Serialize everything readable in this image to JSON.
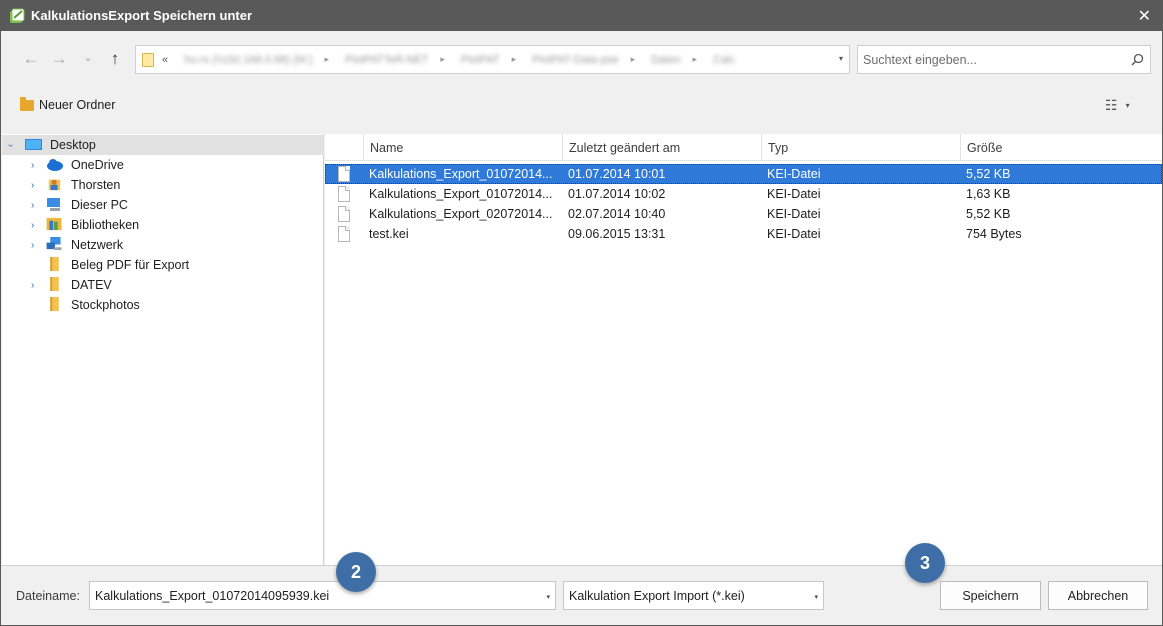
{
  "window": {
    "title": "KalkulationsExport Speichern unter",
    "app_icon": "kalkulation-app-icon",
    "close_glyph": "✕"
  },
  "nav": {
    "back_glyph": "←",
    "forward_glyph": "→",
    "recent_glyph": "⌄",
    "up_glyph": "↑",
    "address": {
      "chevron": "«",
      "crumbs": [
        "hu-rs (\\\\192.168.0.88) (M:)",
        "PlotPATTeR.NET",
        "PlotPAT",
        "PlotPAT-Data-pse",
        "Daten",
        "Calc"
      ],
      "dropdown_glyph": "▾"
    },
    "search_placeholder": "Suchtext eingeben..."
  },
  "toolbar": {
    "new_folder_label": "Neuer Ordner",
    "view_glyph": "☷",
    "view_dropdown_glyph": "▾"
  },
  "tree": {
    "items": [
      {
        "label": "Desktop",
        "icon": "desktop-icon",
        "expanded": true
      },
      {
        "label": "OneDrive",
        "icon": "onedrive-cloud-icon"
      },
      {
        "label": "Thorsten",
        "icon": "user-folder-icon"
      },
      {
        "label": "Dieser PC",
        "icon": "computer-icon"
      },
      {
        "label": "Bibliotheken",
        "icon": "libraries-icon"
      },
      {
        "label": "Netzwerk",
        "icon": "network-icon"
      },
      {
        "label": "Beleg PDF für Export",
        "icon": "folder-icon"
      },
      {
        "label": "DATEV",
        "icon": "folder-icon"
      },
      {
        "label": "Stockphotos",
        "icon": "folder-icon"
      }
    ]
  },
  "files": {
    "columns": [
      "Name",
      "Zuletzt geändert am",
      "Typ",
      "Größe"
    ],
    "rows": [
      {
        "name": "Kalkulations_Export_01072014...",
        "date": "01.07.2014 10:01",
        "type": "KEI-Datei",
        "size": "5,52 KB",
        "selected": true
      },
      {
        "name": "Kalkulations_Export_01072014...",
        "date": "01.07.2014 10:02",
        "type": "KEI-Datei",
        "size": "1,63 KB"
      },
      {
        "name": "Kalkulations_Export_02072014...",
        "date": "02.07.2014 10:40",
        "type": "KEI-Datei",
        "size": "5,52 KB"
      },
      {
        "name": "test.kei",
        "date": "09.06.2015 13:31",
        "type": "KEI-Datei",
        "size": "754 Bytes"
      }
    ]
  },
  "bottom": {
    "filename_label": "Dateiname:",
    "filename_value": "Kalkulations_Export_01072014095939.kei",
    "filetype_value": "Kalkulation Export Import (*.kei)",
    "save_label": "Speichern",
    "cancel_label": "Abbrechen",
    "dropdown_glyph": "▾"
  },
  "badges": {
    "filename_step": "2",
    "save_step": "3",
    "color": "#3f6ea6"
  },
  "colors": {
    "titlebar": "#595959",
    "selection": "#2f7ad9",
    "tree_selection": "#e1e1e1"
  }
}
